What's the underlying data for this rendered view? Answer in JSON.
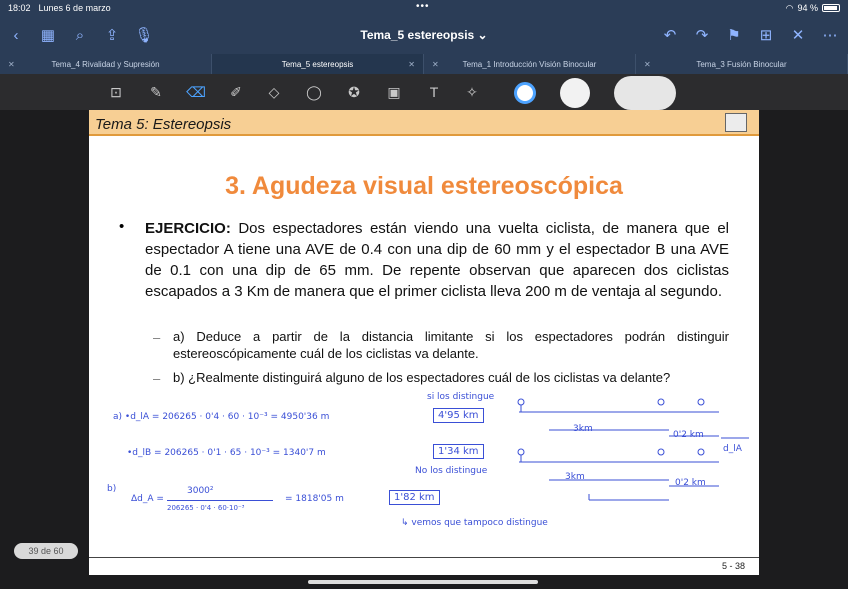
{
  "status": {
    "time": "18:02",
    "date": "Lunes 6 de marzo",
    "battery": "94 %"
  },
  "nav": {
    "title": "Tema_5 estereopsis"
  },
  "tabs": [
    {
      "label": "Tema_4 Rivalidad y Supresión"
    },
    {
      "label": "Tema_5 estereopsis"
    },
    {
      "label": "Tema_1 Introducción Visión Binocular"
    },
    {
      "label": "Tema_3 Fusión Binocular"
    }
  ],
  "slide": {
    "header": "Tema 5: Estereopsis",
    "title": "3. Agudeza visual estereoscópica",
    "exercise_label": "EJERCICIO:",
    "exercise_text": " Dos espectadores están viendo una vuelta ciclista, de manera que el espectador A tiene una AVE de 0.4 con una dip de 60 mm y el espectador B una AVE de 0.1 con una dip de 65 mm. De repente observan que aparecen dos ciclistas escapados a 3 Km de manera que el primer ciclista lleva 200 m de ventaja al segundo.",
    "sub_a": "a) Deduce a partir de la distancia limitante si los espectadores podrán distinguir estereoscópicamente cuál de los ciclistas va delante.",
    "sub_b": "b) ¿Realmente distinguirá alguno de los espectadores cuál de los ciclistas va delante?",
    "number": "5 - 38"
  },
  "handwriting": {
    "line1": "a) •d_lA = 206265 · 0'4 · 60 · 10⁻³ = 4950'36 m",
    "line1_box": "4'95 km",
    "note_top": "si los distingue",
    "line2": "•d_lB = 206265 · 0'1 · 65 · 10⁻³ = 1340'7 m",
    "line2_box": "1'34 km",
    "note_mid": "No los distingue",
    "line3_prefix": "b)",
    "line3_lhs": "Δd_A =",
    "line3_num": "3000²",
    "line3_den": "206265 · 0'4 · 60·10⁻³",
    "line3_rhs": "= 1818'05 m",
    "line3_box": "1'82 km",
    "note_bottom": "↳ vemos que tampoco distingue",
    "diag_3km_1": "3km",
    "diag_02_1": "0'2 km",
    "diag_3km_2": "3km",
    "diag_02_2": "0'2 km",
    "diag_dlA": "d_lA"
  },
  "page_indicator": "39 de 60",
  "colors": {
    "accent": "#f08a3c",
    "chrome": "#2b3d57",
    "ink": "#3a4fd6"
  }
}
